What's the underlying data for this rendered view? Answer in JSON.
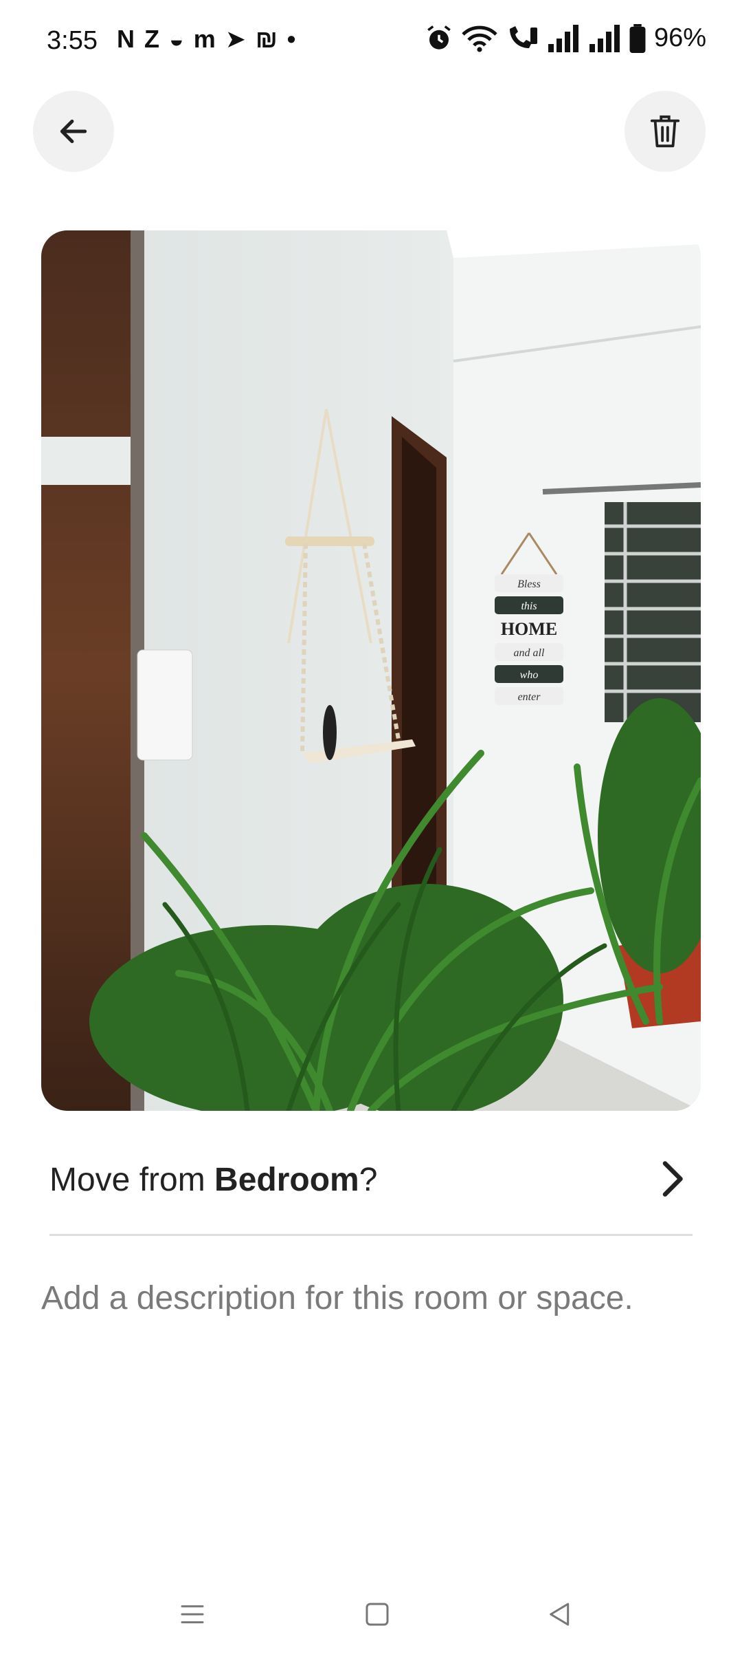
{
  "status_bar": {
    "time": "3:55",
    "left_icons": [
      "N",
      "Z",
      "◒",
      "m",
      "➤",
      "₪",
      "•"
    ],
    "battery": "96%"
  },
  "header": {
    "back_icon": "arrow-left-icon",
    "delete_icon": "trash-icon"
  },
  "photo": {
    "sign_lines": [
      "Bless",
      "this",
      "HOME",
      "and all",
      "who",
      "enter"
    ]
  },
  "move_row": {
    "prefix": "Move from ",
    "room": "Bedroom",
    "suffix": "?"
  },
  "description": {
    "placeholder": "Add a description for this room or space."
  },
  "colors": {
    "accent": "#222222",
    "divider": "#dddddd",
    "button_bg": "#f1f1f1",
    "placeholder": "#7a7a7a"
  }
}
